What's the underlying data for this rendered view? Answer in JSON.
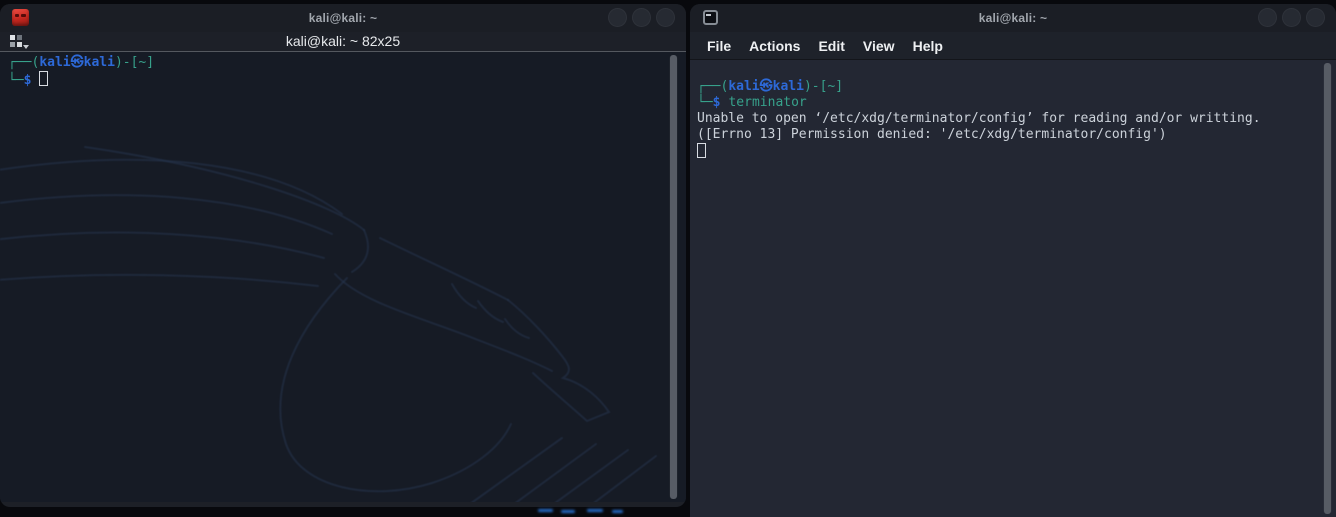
{
  "left_window": {
    "titlebar": {
      "title": "kali@kali: ~"
    },
    "tabbar": {
      "tab_title": "kali@kali: ~ 82x25"
    },
    "terminal": {
      "prompt": {
        "frame_open": "┌──(",
        "user_host": "kali㉿kali",
        "frame_mid": ")-[",
        "path": "~",
        "frame_close": "]",
        "frame_line2": "└─",
        "dollar": "$"
      }
    }
  },
  "right_window": {
    "titlebar": {
      "title": "kali@kali: ~"
    },
    "menu": {
      "items": [
        "File",
        "Actions",
        "Edit",
        "View",
        "Help"
      ]
    },
    "terminal": {
      "prompt": {
        "frame_open": "┌──(",
        "user_host": "kali㉿kali",
        "frame_mid": ")-[",
        "path": "~",
        "frame_close": "]",
        "frame_line2": "└─",
        "dollar": "$"
      },
      "command": "terminator",
      "output": [
        "Unable to open ‘/etc/xdg/terminator/config’ for reading and/or writting.",
        "([Errno 13] Permission denied: '/etc/xdg/terminator/config')"
      ]
    }
  },
  "colors": {
    "desktop_bg": "#08090d",
    "titlebar_bg": "#1b1e25",
    "left_terminal_bg": "#161b25",
    "right_terminal_bg": "#232733",
    "prompt_frame_teal": "#37a18b",
    "prompt_user_blue": "#2d69d7",
    "terminal_fg": "#ccd2da",
    "app_icon_red": "#c4271f",
    "wallpaper_accent_blue": "#2a79e0"
  }
}
